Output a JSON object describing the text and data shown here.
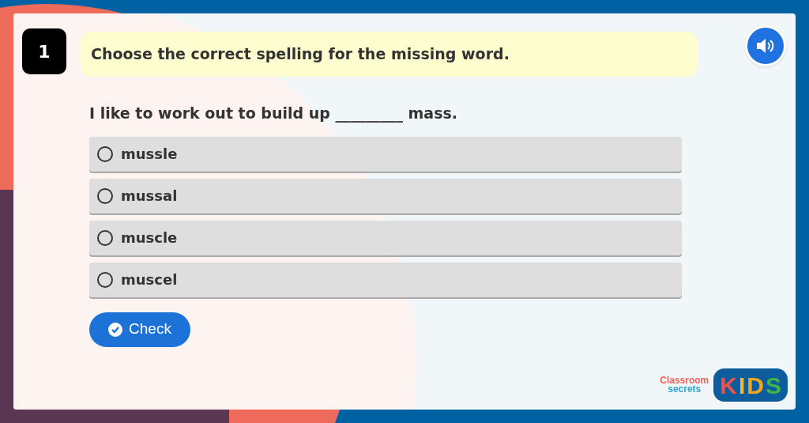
{
  "question_number": "1",
  "instruction": "Choose the correct spelling for the missing word.",
  "question": "I like to work out to build up _________ mass.",
  "options": [
    {
      "label": "mussle",
      "selected": false
    },
    {
      "label": "mussal",
      "selected": false
    },
    {
      "label": "muscle",
      "selected": false
    },
    {
      "label": "muscel",
      "selected": false
    }
  ],
  "check_button": "Check",
  "logo": {
    "line_1": "Classroom",
    "line_2": "secrets",
    "badge_letters": [
      {
        "letter": "K",
        "color": "#f0524a"
      },
      {
        "letter": "I",
        "color": "#f7b32b"
      },
      {
        "letter": "D",
        "color": "#f7a51e"
      },
      {
        "letter": "S",
        "color": "#3cb54a"
      }
    ]
  }
}
